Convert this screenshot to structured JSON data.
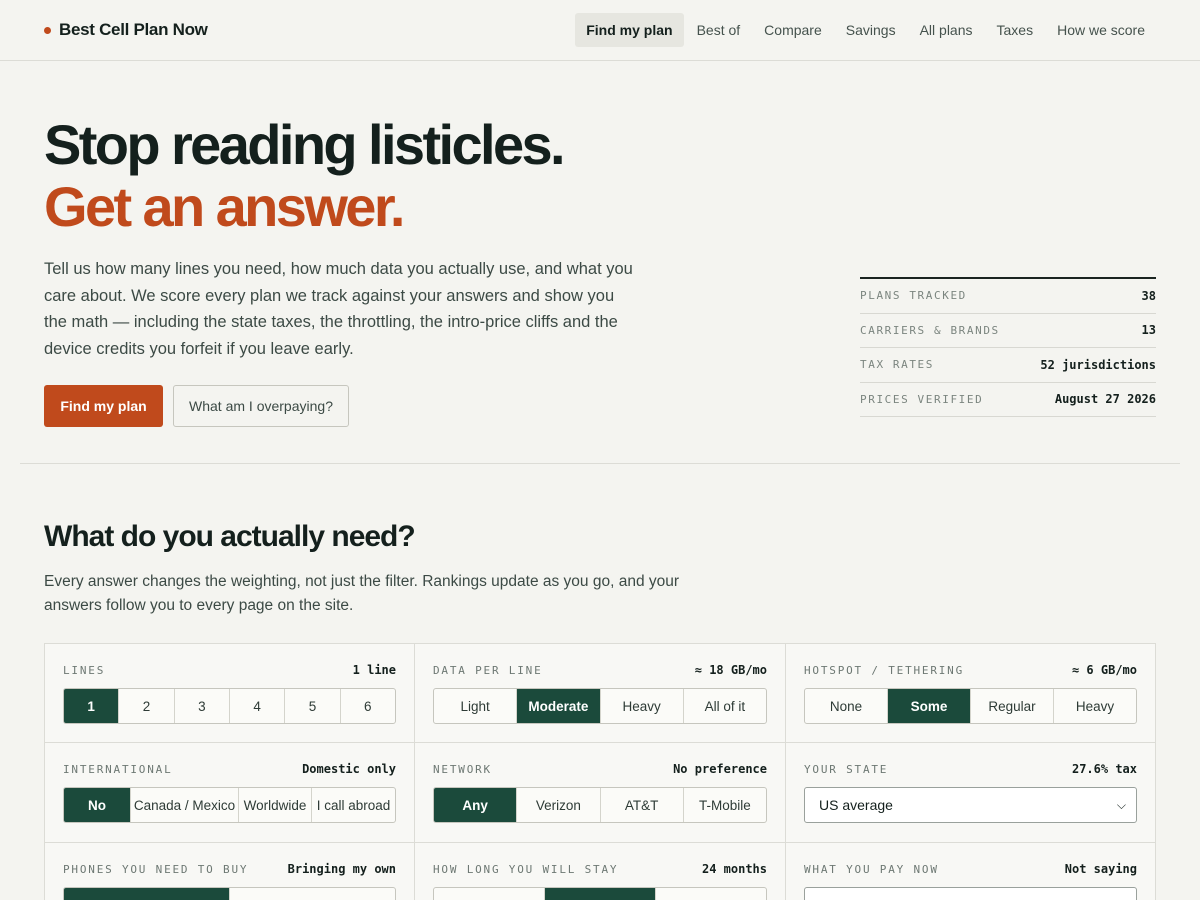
{
  "brand": {
    "name": "Best Cell Plan Now"
  },
  "nav": {
    "items": [
      "Find my plan",
      "Best of",
      "Compare",
      "Savings",
      "All plans",
      "Taxes",
      "How we score"
    ],
    "active": "Find my plan"
  },
  "hero": {
    "title_line1": "Stop reading listicles.",
    "title_line2": "Get an answer.",
    "copy": "Tell us how many lines you need, how much data you actually use, and what you care about. We score every plan we track against your answers and show you the math — including the state taxes, the throttling, the intro-price cliffs and the device credits you forfeit if you leave early.",
    "primary_cta": "Find my plan",
    "secondary_cta": "What am I overpaying?"
  },
  "stats": [
    {
      "label": "PLANS TRACKED",
      "value": "38"
    },
    {
      "label": "CARRIERS & BRANDS",
      "value": "13"
    },
    {
      "label": "TAX RATES",
      "value": "52 jurisdictions"
    },
    {
      "label": "PRICES VERIFIED",
      "value": "August 27 2026"
    }
  ],
  "needs": {
    "title": "What do you actually need?",
    "subtitle": "Every answer changes the weighting, not just the filter. Rankings update as you go, and your answers follow you to every page on the site.",
    "questions": [
      {
        "label": "LINES",
        "value": "1 line",
        "options": [
          "1",
          "2",
          "3",
          "4",
          "5",
          "6"
        ],
        "selected": "1"
      },
      {
        "label": "DATA PER LINE",
        "value": "≈ 18 GB/mo",
        "options": [
          "Light",
          "Moderate",
          "Heavy",
          "All of it"
        ],
        "selected": "Moderate"
      },
      {
        "label": "HOTSPOT / TETHERING",
        "value": "≈ 6 GB/mo",
        "options": [
          "None",
          "Some",
          "Regular",
          "Heavy"
        ],
        "selected": "Some"
      },
      {
        "label": "INTERNATIONAL",
        "value": "Domestic only",
        "options": [
          "No",
          "Canada / Mexico",
          "Worldwide",
          "I call abroad"
        ],
        "selected": "No"
      },
      {
        "label": "NETWORK",
        "value": "No preference",
        "options": [
          "Any",
          "Verizon",
          "AT&T",
          "T-Mobile"
        ],
        "selected": "Any"
      },
      {
        "label": "YOUR STATE",
        "value": "27.6% tax",
        "select_value": "US average"
      },
      {
        "label": "PHONES YOU NEED TO BUY",
        "value": "Bringing my own",
        "options": [
          "",
          ""
        ],
        "selected": ""
      },
      {
        "label": "HOW LONG YOU WILL STAY",
        "value": "24 months",
        "options": [
          "",
          "",
          ""
        ],
        "selected": ""
      },
      {
        "label": "WHAT YOU PAY NOW",
        "value": "Not saying",
        "select_value": ""
      }
    ]
  }
}
